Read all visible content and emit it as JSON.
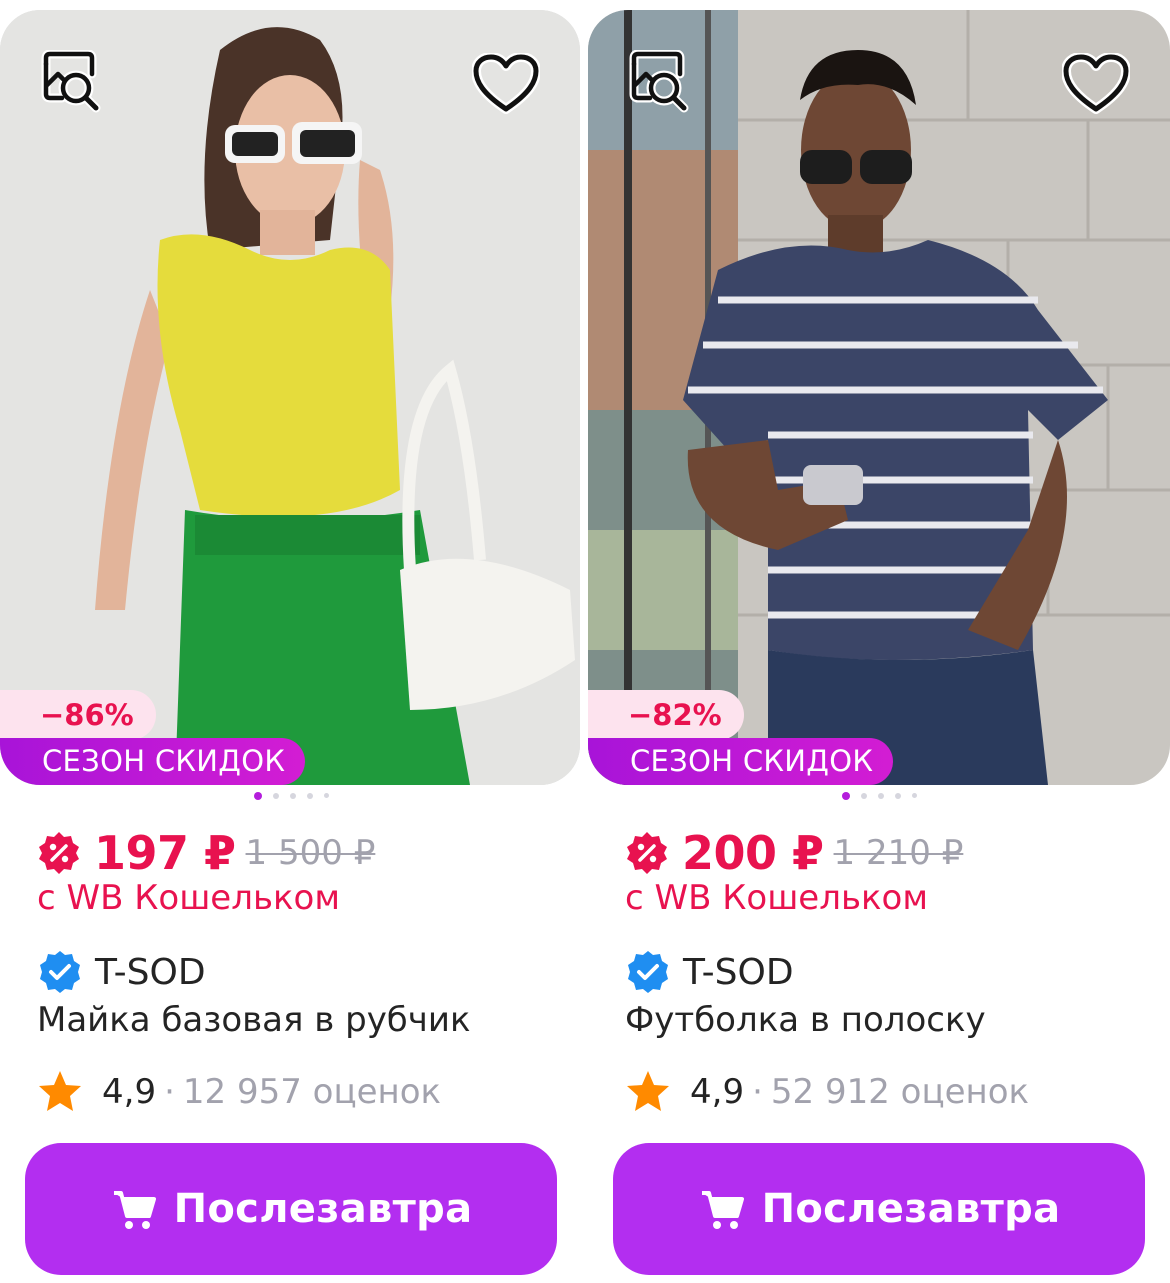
{
  "colors": {
    "accent_purple": "#b32ef0",
    "price_red": "#e8124f",
    "discount_bg": "#fde3ee",
    "muted_gray": "#a2a2ad",
    "verified_blue": "#1f8ef1",
    "star_orange": "#ff8a00"
  },
  "icons": {
    "image_search": "image-search-icon",
    "favorite": "heart-outline-icon",
    "price": "discount-percent-icon",
    "verified": "verified-check-icon",
    "rating": "star-icon",
    "cart": "cart-icon"
  },
  "products": [
    {
      "photo_description": "woman-in-yellow-tank-top",
      "discount": "−86%",
      "promo": "СЕЗОН СКИДОК",
      "image_count": 5,
      "active_image": 1,
      "price": "197 ₽",
      "old_price": "1 500 ₽",
      "wallet_note": "с WB Кошельком",
      "brand": "T-SOD",
      "name": "Майка базовая в рубчик",
      "rating": "4,9",
      "separator": "·",
      "reviews": "12 957 оценок",
      "button_label": "Послезавтра"
    },
    {
      "photo_description": "man-in-striped-t-shirt",
      "discount": "−82%",
      "promo": "СЕЗОН СКИДОК",
      "image_count": 5,
      "active_image": 1,
      "price": "200 ₽",
      "old_price": "1 210 ₽",
      "wallet_note": "с WB Кошельком",
      "brand": "T-SOD",
      "name": "Футболка в полоску",
      "rating": "4,9",
      "separator": "·",
      "reviews": "52 912 оценок",
      "button_label": "Послезавтра"
    }
  ]
}
